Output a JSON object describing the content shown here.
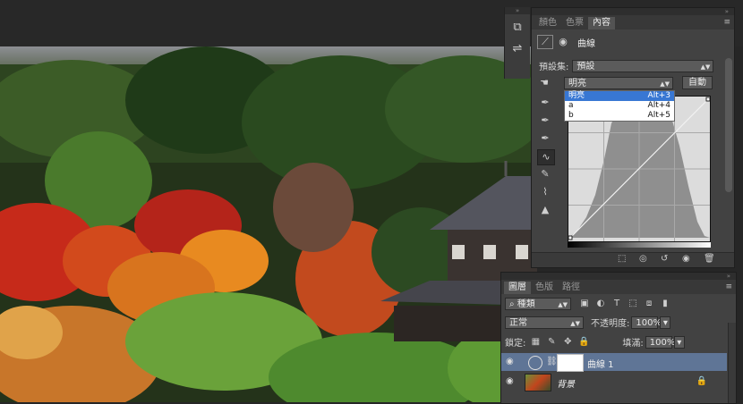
{
  "collapse_glyph": "»",
  "tool_strip": {
    "tools": [
      "histogram-brush-icon",
      "adjust-sliders-icon"
    ]
  },
  "properties_panel": {
    "tabs": [
      "顏色",
      "色票",
      "內容"
    ],
    "active_tab": 2,
    "title": "曲線",
    "preset_label": "預設集:",
    "preset_value": "預設",
    "channel_value": "明亮",
    "auto_label": "自動",
    "channel_options": [
      {
        "label": "明亮",
        "shortcut": "Alt+3"
      },
      {
        "label": "a",
        "shortcut": "Alt+4"
      },
      {
        "label": "b",
        "shortcut": "Alt+5"
      }
    ],
    "side_tools": [
      "hand-target-icon",
      "black-eyedropper-icon",
      "gray-eyedropper-icon",
      "white-eyedropper-icon",
      "curve-point-icon",
      "pencil-icon",
      "smooth-icon",
      "clipping-warning-icon"
    ],
    "bottom_icons": [
      "clip-to-layer-icon",
      "view-previous-icon",
      "reset-icon",
      "visibility-icon",
      "trash-icon"
    ]
  },
  "layers_panel": {
    "tabs": [
      "圖層",
      "色版",
      "路徑"
    ],
    "active_tab": 0,
    "filter_label": "種類",
    "blend_mode": "正常",
    "opacity_label": "不透明度:",
    "opacity_value": "100%",
    "lock_label": "鎖定:",
    "fill_label": "填滿:",
    "fill_value": "100%",
    "layers": [
      {
        "name": "曲線 1",
        "selected": true
      },
      {
        "name": "背景",
        "selected": false
      }
    ]
  },
  "colors": {
    "panel": "#424242",
    "selection": "#3877d3",
    "layer_selected": "#5f7596"
  }
}
